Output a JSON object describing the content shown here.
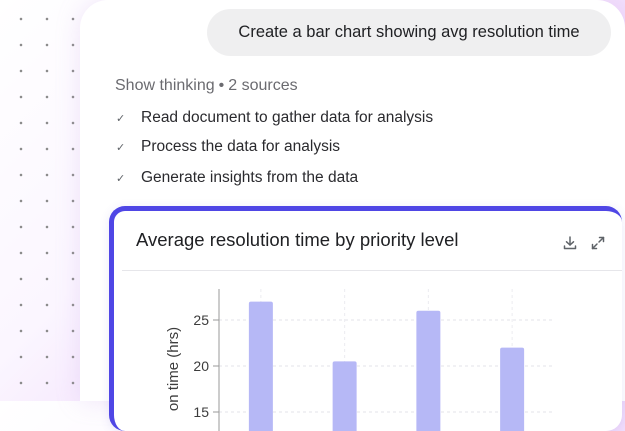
{
  "conversation": {
    "prompt": "Create a bar chart showing avg resolution time",
    "thinking_label": "Show thinking",
    "thinking_separator": "•",
    "sources_label": "2 sources",
    "steps": [
      "Read document to gather data for analysis",
      "Process the data for analysis",
      "Generate insights from the data"
    ]
  },
  "chart_card": {
    "title": "Average resolution time by priority level",
    "download_icon": "download-icon",
    "expand_icon": "expand-icon"
  },
  "chart_data": {
    "type": "bar",
    "title": "Average resolution time by priority level",
    "ylabel": "on time (hrs)",
    "xlabel": "",
    "ylim_visible": [
      15,
      27.5
    ],
    "yticks": [
      25,
      20,
      15
    ],
    "categories": [
      "",
      "",
      "",
      ""
    ],
    "values": [
      27,
      20.5,
      26,
      22
    ],
    "bar_color": "#b6b8f6",
    "grid": true
  },
  "colors": {
    "accent": "#4f46e5",
    "bubble": "#efeff0"
  }
}
